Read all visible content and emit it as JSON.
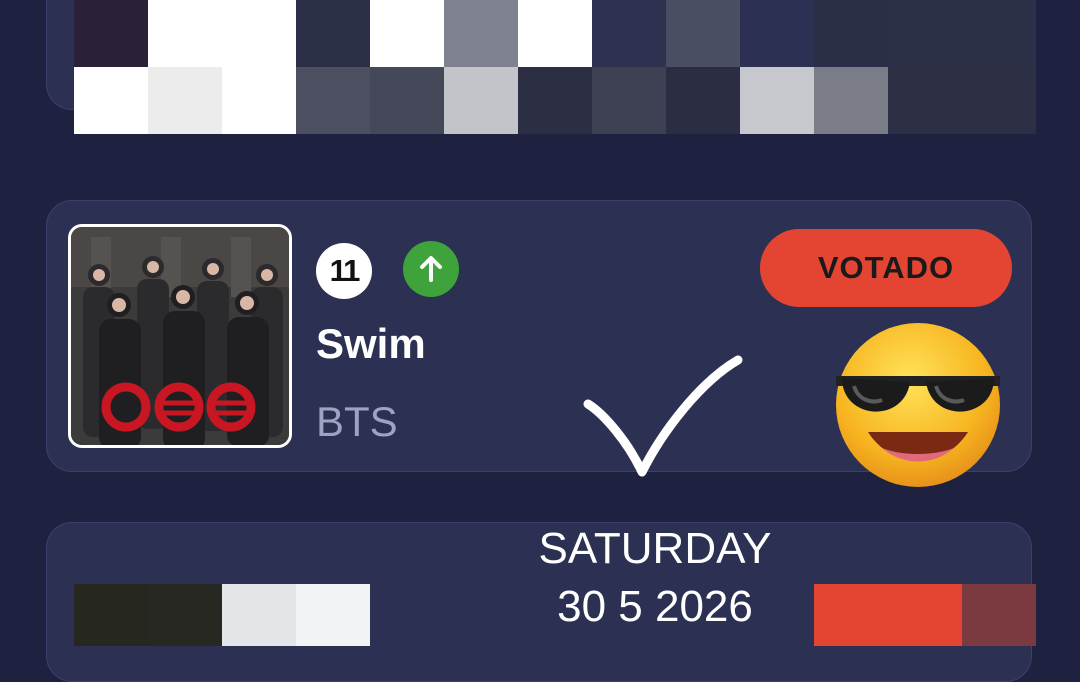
{
  "entry": {
    "rank": "11",
    "trend_icon": "arrow-up-icon",
    "title": "Swim",
    "artist": "BTS",
    "vote_label": "VOTADO",
    "album_art": "album-cover-image"
  },
  "overlay": {
    "date_day": "SATURDAY",
    "date_value": "30 5 2026",
    "sticker_checkmark": "checkmark-icon",
    "sticker_emoji": "sunglasses-emoji"
  },
  "colors": {
    "background": "#1e2140",
    "card": "#2c3052",
    "vote_button": "#e34532",
    "trend_up": "#3da33a",
    "artist_text": "#9ea3c0"
  }
}
